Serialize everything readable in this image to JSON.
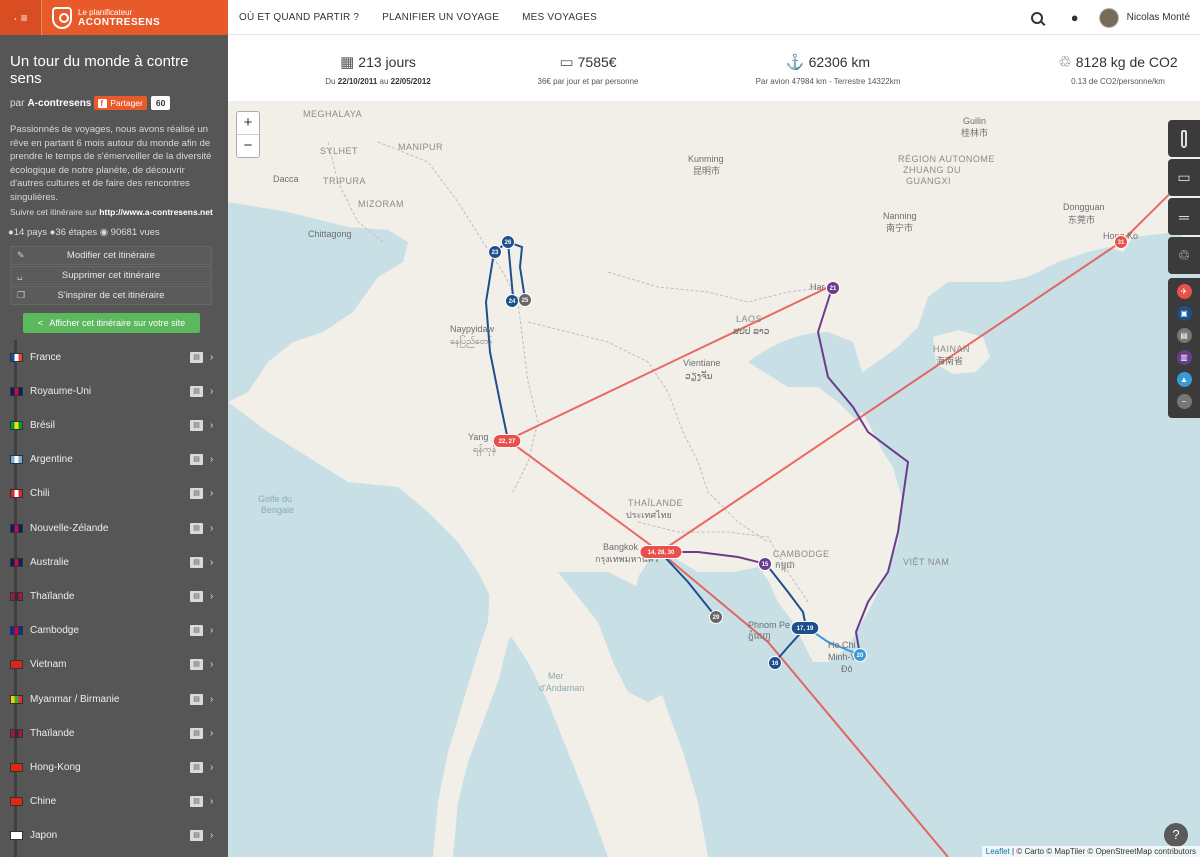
{
  "brand": {
    "menu_icon": "· ≡",
    "logo_small": "Le planificateur",
    "logo_big": "ACONTRESENS"
  },
  "trip": {
    "title": "Un tour du monde à contre sens",
    "by": "par",
    "author": "A-contresens",
    "share_label": "Partager",
    "share_count": "60",
    "description": "Passionnés de voyages, nous avons réalisé un rêve en partant 6 mois autour du monde afin de prendre le temps de s'émerveiller de la diversité écologique de notre planète, de découvrir d'autres cultures et de faire des rencontres singulières.",
    "follow_prefix": "Suivre cet itinéraire sur",
    "follow_url": "http://www.a-contresens.net",
    "stats_line": "●14 pays ●36 étapes ◉ 90681 vues"
  },
  "actions": [
    {
      "label": "Modifier cet itinéraire",
      "icon": "✎"
    },
    {
      "label": "Supprimer cet itinéraire",
      "icon": "␣"
    },
    {
      "label": "S'inspirer de cet itinéraire",
      "icon": "❐"
    }
  ],
  "embed_label": "Afficher cet itinéraire sur votre site",
  "countries": [
    {
      "name": "France",
      "flag": [
        "#0055a4",
        "#ffffff",
        "#ef4135"
      ]
    },
    {
      "name": "Royaume-Uni",
      "flag": [
        "#012169",
        "#c8102e",
        "#012169"
      ]
    },
    {
      "name": "Brésil",
      "flag": [
        "#009c3b",
        "#ffdf00",
        "#009c3b"
      ]
    },
    {
      "name": "Argentine",
      "flag": [
        "#74acdf",
        "#ffffff",
        "#74acdf"
      ]
    },
    {
      "name": "Chili",
      "flag": [
        "#d52b1e",
        "#ffffff",
        "#d52b1e"
      ]
    },
    {
      "name": "Nouvelle-Zélande",
      "flag": [
        "#012169",
        "#c8102e",
        "#012169"
      ]
    },
    {
      "name": "Australie",
      "flag": [
        "#012169",
        "#c8102e",
        "#012169"
      ]
    },
    {
      "name": "Thaïlande",
      "flag": [
        "#a51931",
        "#2d2a4a",
        "#a51931"
      ]
    },
    {
      "name": "Cambodge",
      "flag": [
        "#032ea1",
        "#e00025",
        "#032ea1"
      ]
    },
    {
      "name": "Vietnam",
      "flag": [
        "#da251d",
        "#da251d",
        "#da251d"
      ]
    },
    {
      "name": "Myanmar / Birmanie",
      "flag": [
        "#fecb00",
        "#34b233",
        "#ea2839"
      ]
    },
    {
      "name": "Thaïlande",
      "flag": [
        "#a51931",
        "#2d2a4a",
        "#a51931"
      ]
    },
    {
      "name": "Hong-Kong",
      "flag": [
        "#de2910",
        "#de2910",
        "#de2910"
      ]
    },
    {
      "name": "Chine",
      "flag": [
        "#de2910",
        "#de2910",
        "#de2910"
      ]
    },
    {
      "name": "Japon",
      "flag": [
        "#ffffff",
        "#ffffff",
        "#ffffff"
      ]
    }
  ],
  "nav": {
    "links": [
      "OÙ ET QUAND PARTIR ?",
      "PLANIFIER UN VOYAGE",
      "MES VOYAGES"
    ],
    "user": "Nicolas Monté"
  },
  "stats": [
    {
      "value": "213 jours",
      "icon": "▦",
      "sub_parts": [
        "Du ",
        "22/10/2011",
        " au ",
        "22/05/2012"
      ]
    },
    {
      "value": "7585€",
      "icon": "▭",
      "sub_parts": [
        "36€ par jour et par personne"
      ]
    },
    {
      "value": "62306 km",
      "icon": "⚓",
      "sub_parts": [
        "Par avion 47984 km - Terrestre 14322km"
      ]
    },
    {
      "value": "8128 kg de CO2",
      "icon": "♲",
      "sub_parts": [
        "0.13 de CO2/personne/km"
      ]
    }
  ],
  "map": {
    "zoom_in": "+",
    "zoom_out": "−",
    "attribution_link": "Leaflet",
    "attribution_rest": " | © Carto © MapTiler © OpenStreetMap contributors",
    "help_icon": "❓",
    "labels": [
      {
        "t": "MEGHALAYA",
        "c": "maplbl2"
      },
      {
        "t": "MANIPUR",
        "c": "maplbl2"
      },
      {
        "t": "SYLHET",
        "c": "maplbl2"
      },
      {
        "t": "TRIPURA",
        "c": "maplbl2"
      },
      {
        "t": "MIZORAM",
        "c": "maplbl2"
      },
      {
        "t": "Dacca",
        "c": "maplbl"
      },
      {
        "t": "Chittagong",
        "c": "maplbl"
      },
      {
        "t": "Kunming",
        "c": "maplbl"
      },
      {
        "t": "昆明市",
        "c": "maplbl"
      },
      {
        "t": "Guilin",
        "c": "maplbl"
      },
      {
        "t": "桂林市",
        "c": "maplbl"
      },
      {
        "t": "RÉGION AUTONOME",
        "c": "maplbl2"
      },
      {
        "t": "ZHUANG DU",
        "c": "maplbl2"
      },
      {
        "t": "GUANGXI",
        "c": "maplbl2"
      },
      {
        "t": "Nanning",
        "c": "maplbl"
      },
      {
        "t": "南宁市",
        "c": "maplbl"
      },
      {
        "t": "Dongguan",
        "c": "maplbl"
      },
      {
        "t": "东莞市",
        "c": "maplbl"
      },
      {
        "t": "Hong Ko",
        "c": "maplbl"
      },
      {
        "t": "Naypyidaw",
        "c": "maplbl"
      },
      {
        "t": "နေပြည်တော်",
        "c": "maplbl"
      },
      {
        "t": "Yang",
        "c": "maplbl"
      },
      {
        "t": "ရန်ကုန်",
        "c": "maplbl"
      },
      {
        "t": "LAOS",
        "c": "maplbl2"
      },
      {
        "t": "ສປປ ລາວ",
        "c": "maplbl"
      },
      {
        "t": "Vientiane",
        "c": "maplbl"
      },
      {
        "t": "ວຽງຈັນ",
        "c": "maplbl"
      },
      {
        "t": "HAINAN",
        "c": "maplbl2"
      },
      {
        "t": "海南省",
        "c": "maplbl"
      },
      {
        "t": "Har",
        "c": "maplbl"
      },
      {
        "t": "Golfe du",
        "c": "sealbl"
      },
      {
        "t": "Bengale",
        "c": "sealbl"
      },
      {
        "t": "THAÏLANDE",
        "c": "maplbl2"
      },
      {
        "t": "ประเทศไทย",
        "c": "maplbl"
      },
      {
        "t": "Bangkok",
        "c": "maplbl"
      },
      {
        "t": "กรุงเทพมหานคร",
        "c": "maplbl"
      },
      {
        "t": "CAMBODGE",
        "c": "maplbl2"
      },
      {
        "t": "កម្ពុជា",
        "c": "maplbl"
      },
      {
        "t": "VIỆT NAM",
        "c": "maplbl2"
      },
      {
        "t": "Phnom Pe",
        "c": "maplbl"
      },
      {
        "t": "ភ្នំពេញ",
        "c": "maplbl"
      },
      {
        "t": "Ho Chi",
        "c": "maplbl"
      },
      {
        "t": "Minh-V",
        "c": "maplbl"
      },
      {
        "t": "Đô",
        "c": "maplbl"
      },
      {
        "t": "Mer",
        "c": "sealbl"
      },
      {
        "t": "d'Andaman",
        "c": "sealbl"
      }
    ],
    "markers": [
      {
        "t": "26",
        "color": "#1d4f8c"
      },
      {
        "t": "23",
        "color": "#1d4f8c"
      },
      {
        "t": "24",
        "color": "#1d4f8c"
      },
      {
        "t": "25",
        "color": "#666666"
      },
      {
        "t": "22, 27",
        "color": "#e8504a"
      },
      {
        "t": "21",
        "color": "#6a3c8c"
      },
      {
        "t": "31",
        "color": "#e8504a"
      },
      {
        "t": "14, 28, 30",
        "color": "#e8504a"
      },
      {
        "t": "15",
        "color": "#6a3c8c"
      },
      {
        "t": "29",
        "color": "#666666"
      },
      {
        "t": "17, 19",
        "color": "#1d4f8c"
      },
      {
        "t": "16",
        "color": "#1d4f8c"
      },
      {
        "t": "20",
        "color": "#3a9ad9"
      }
    ],
    "controls": [
      {
        "icon": "thermometer-icon",
        "glyph": " "
      },
      {
        "icon": "wallet-icon",
        "glyph": "▭"
      },
      {
        "icon": "route-icon",
        "glyph": "═"
      },
      {
        "icon": "recycle-icon",
        "glyph": "♲"
      }
    ],
    "modes": [
      {
        "icon": "plane-icon",
        "color": "#e8504a",
        "glyph": "✈"
      },
      {
        "icon": "bus-icon",
        "color": "#1d4f8c",
        "glyph": "▣"
      },
      {
        "icon": "truck-icon",
        "color": "#777777",
        "glyph": "▤"
      },
      {
        "icon": "train-icon",
        "color": "#6a3c8c",
        "glyph": "▥"
      },
      {
        "icon": "boat-icon",
        "color": "#3a9ad9",
        "glyph": "▲"
      },
      {
        "icon": "walk-icon",
        "color": "#777777",
        "glyph": "−"
      }
    ]
  },
  "colors": {
    "brand": "#e95a2a",
    "sidebar": "#565656",
    "plane": "#e8504a",
    "bus": "#1d4f8c",
    "train": "#6a3c8c",
    "boat": "#3a9ad9"
  }
}
